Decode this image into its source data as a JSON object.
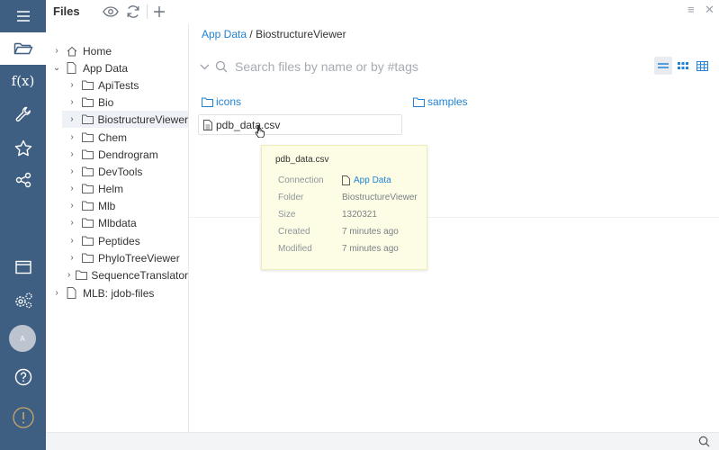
{
  "app": {
    "panel_title": "Files"
  },
  "rail": {
    "items": [
      {
        "icon": "menu-icon"
      },
      {
        "icon": "folder-open-icon",
        "active": true
      },
      {
        "icon": "function-icon",
        "label": "f(x)"
      },
      {
        "icon": "wrench-icon"
      },
      {
        "icon": "star-icon"
      },
      {
        "icon": "share-nodes-icon"
      },
      {
        "icon": "window-icon"
      },
      {
        "icon": "settings-gears-icon"
      },
      {
        "icon": "help-icon",
        "label": "?"
      },
      {
        "icon": "alert-icon",
        "label": "!"
      }
    ],
    "avatar_initial": "A"
  },
  "tree": {
    "items": [
      {
        "label": "Home",
        "expanded": false,
        "level": 0,
        "icon": "home-icon"
      },
      {
        "label": "App Data",
        "expanded": true,
        "level": 0,
        "icon": "file-icon"
      },
      {
        "label": "ApiTests",
        "level": 1,
        "icon": "folder-icon"
      },
      {
        "label": "Bio",
        "level": 1,
        "icon": "folder-icon"
      },
      {
        "label": "BiostructureViewer",
        "level": 1,
        "icon": "folder-icon",
        "selected": true
      },
      {
        "label": "Chem",
        "level": 1,
        "icon": "folder-icon"
      },
      {
        "label": "Dendrogram",
        "level": 1,
        "icon": "folder-icon"
      },
      {
        "label": "DevTools",
        "level": 1,
        "icon": "folder-icon"
      },
      {
        "label": "Helm",
        "level": 1,
        "icon": "folder-icon"
      },
      {
        "label": "Mlb",
        "level": 1,
        "icon": "folder-icon"
      },
      {
        "label": "Mlbdata",
        "level": 1,
        "icon": "folder-icon"
      },
      {
        "label": "Peptides",
        "level": 1,
        "icon": "folder-icon"
      },
      {
        "label": "PhyloTreeViewer",
        "level": 1,
        "icon": "folder-icon"
      },
      {
        "label": "SequenceTranslator",
        "level": 1,
        "icon": "folder-icon"
      },
      {
        "label": "MLB: jdob-files",
        "expanded": false,
        "level": 0,
        "icon": "file-icon"
      }
    ]
  },
  "breadcrumb": {
    "root": "App Data",
    "separator": "/",
    "current": "BiostructureViewer"
  },
  "search": {
    "placeholder": "Search files by name or by #tags",
    "value": ""
  },
  "view_modes": [
    "list-view-icon",
    "grid-view-icon",
    "table-view-icon"
  ],
  "folders": [
    {
      "name": "icons"
    },
    {
      "name": "samples"
    }
  ],
  "files": [
    {
      "name": "pdb_data.csv"
    }
  ],
  "tooltip": {
    "title": "pdb_data.csv",
    "connection_label": "Connection",
    "connection_value": "App Data",
    "folder_label": "Folder",
    "folder_value": "BiostructureViewer",
    "size_label": "Size",
    "size_value": "1320321",
    "created_label": "Created",
    "created_value": "7 minutes ago",
    "modified_label": "Modified",
    "modified_value": "7 minutes ago"
  },
  "colors": {
    "rail_bg": "#3f5f82",
    "link": "#2083d5",
    "tooltip_bg": "#fdfde5"
  }
}
